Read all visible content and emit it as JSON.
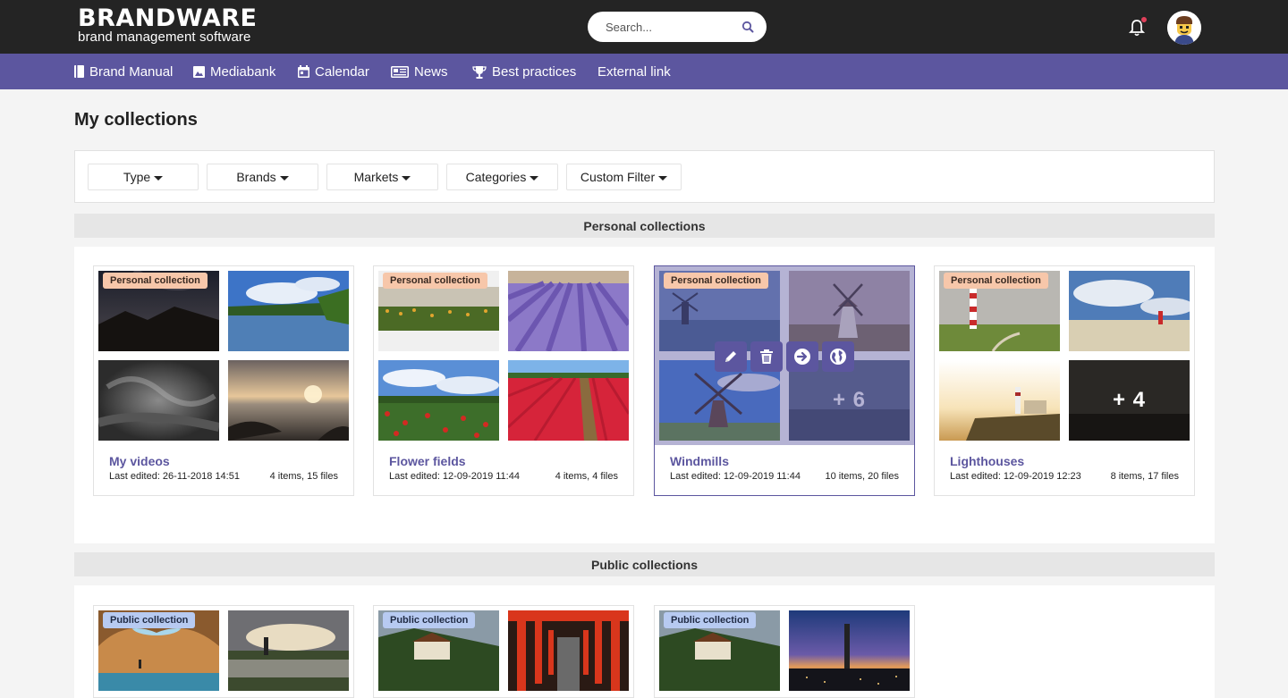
{
  "header": {
    "logo_main": "BRANDWARE",
    "logo_sub": "brand management software",
    "search_placeholder": "Search..."
  },
  "nav": {
    "items": [
      {
        "label": "Brand Manual",
        "icon": "book-icon"
      },
      {
        "label": "Mediabank",
        "icon": "image-icon"
      },
      {
        "label": "Calendar",
        "icon": "calendar-icon"
      },
      {
        "label": "News",
        "icon": "newspaper-icon"
      },
      {
        "label": "Best practices",
        "icon": "trophy-icon"
      },
      {
        "label": "External link",
        "icon": ""
      }
    ]
  },
  "page": {
    "title": "My collections"
  },
  "filters": [
    "Type",
    "Brands",
    "Markets",
    "Categories",
    "Custom Filter"
  ],
  "sections": {
    "personal": {
      "title": "Personal collections",
      "cards": [
        {
          "tag": "Personal collection",
          "title": "My videos",
          "edited": "Last edited: 26-11-2018 14:51",
          "count": "4 items, 15 files"
        },
        {
          "tag": "Personal collection",
          "title": "Flower fields",
          "edited": "Last edited: 12-09-2019 11:44",
          "count": "4 items, 4 files"
        },
        {
          "tag": "Personal collection",
          "title": "Windmills",
          "edited": "Last edited: 12-09-2019 11:44",
          "count": "10 items, 20 files",
          "more": "+ 6"
        },
        {
          "tag": "Personal collection",
          "title": "Lighthouses",
          "edited": "Last edited: 12-09-2019 12:23",
          "count": "8 items, 17 files",
          "more": "+ 4"
        }
      ]
    },
    "public": {
      "title": "Public collections",
      "cards": [
        {
          "tag": "Public collection"
        },
        {
          "tag": "Public collection"
        },
        {
          "tag": "Public collection"
        }
      ]
    }
  },
  "colors": {
    "brand_purple": "#5c569f",
    "topbar": "#242424",
    "personal_tag": "#f7c7aa",
    "public_tag": "#b7caf1"
  }
}
